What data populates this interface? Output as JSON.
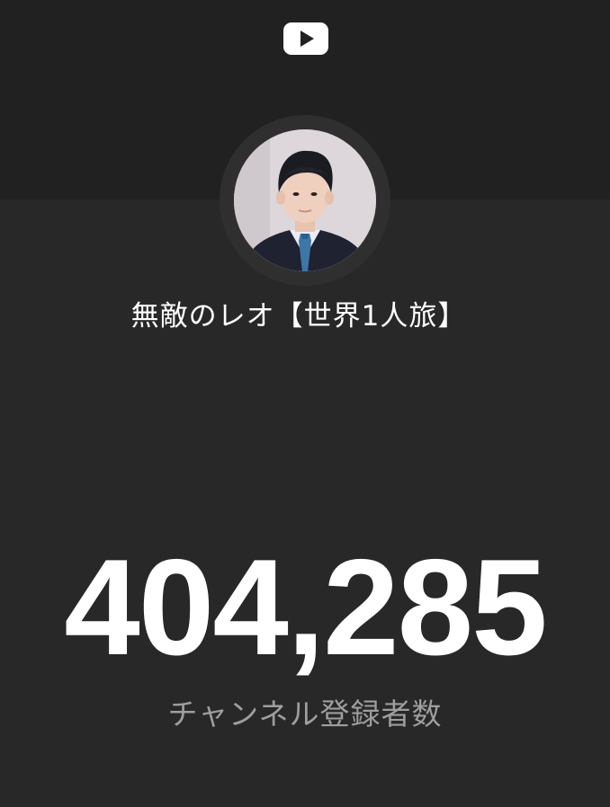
{
  "header": {
    "logo_icon": "youtube-play-icon",
    "background_color": "#212121"
  },
  "channel": {
    "avatar_icon": "channel-avatar-photo",
    "name": "無敵のレオ【世界1人旅】"
  },
  "stats": {
    "subscriber_count": "404,285",
    "subscriber_label": "チャンネル登録者数"
  },
  "colors": {
    "page_background": "#282828",
    "primary_text": "#ffffff",
    "secondary_text": "#9e9e9e"
  }
}
